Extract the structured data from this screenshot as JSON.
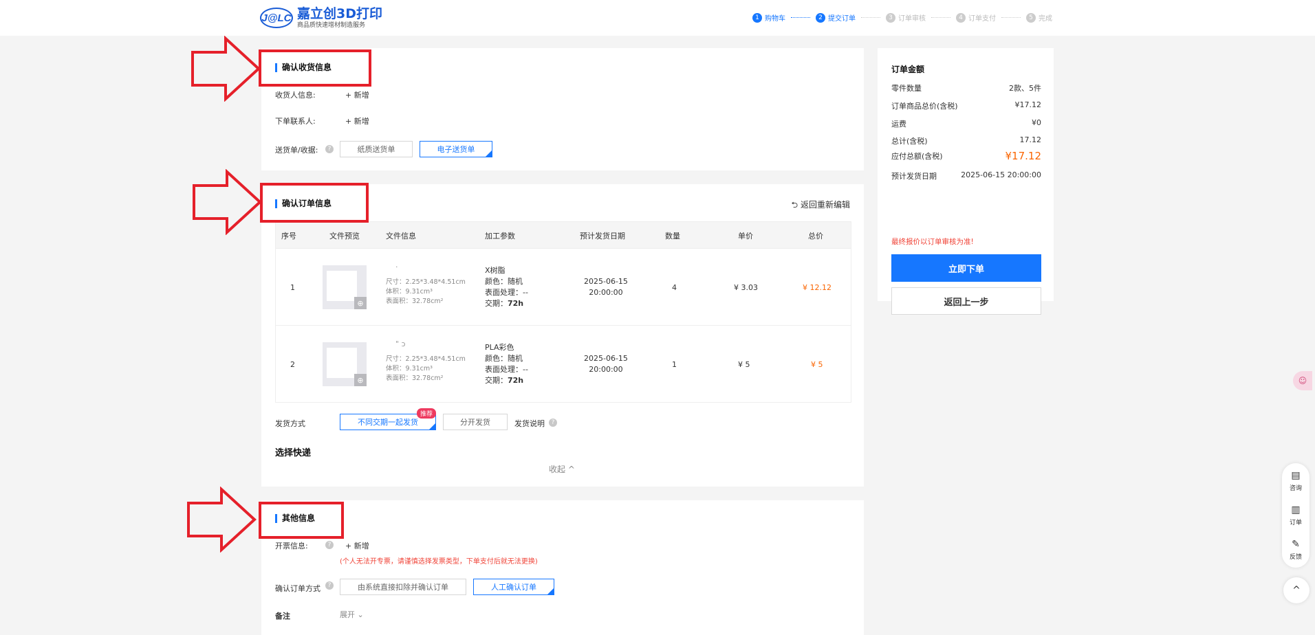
{
  "header": {
    "logo_badge": "J@LC",
    "logo_title": "嘉立创3D打印",
    "logo_sub": "商品质快速增材制造服务",
    "steps": [
      {
        "num": "1",
        "label": "购物车",
        "active": true
      },
      {
        "num": "2",
        "label": "提交订单",
        "active": true
      },
      {
        "num": "3",
        "label": "订单审核",
        "active": false
      },
      {
        "num": "4",
        "label": "订单支付",
        "active": false
      },
      {
        "num": "5",
        "label": "完成",
        "active": false
      }
    ]
  },
  "shipping": {
    "title": "确认收货信息",
    "receiver_label": "收货人信息:",
    "receiver_add": "+ 新增",
    "contact_label": "下单联系人:",
    "contact_add": "+ 新增",
    "receipt_label": "送货单/收据:",
    "receipt_options": [
      "纸质送货单",
      "电子送货单"
    ]
  },
  "order": {
    "title": "确认订单信息",
    "back_edit": "返回重新编辑",
    "columns": [
      "序号",
      "文件预览",
      "文件信息",
      "加工参数",
      "预计发货日期",
      "数量",
      "单价",
      "总价"
    ],
    "rows": [
      {
        "index": "1",
        "file_name": "·",
        "size": "尺寸：2.25*3.48*4.51cm",
        "volume": "体积：9.31cm³",
        "area": "表面积：32.78cm²",
        "material": "X树脂",
        "color": "颜色：随机",
        "surface": "表面处理：--",
        "lead_prefix": "交期：",
        "lead": "72h",
        "date": "2025-06-15",
        "time": "20:00:00",
        "qty": "4",
        "unit_price": "¥ 3.03",
        "total": "¥ 12.12"
      },
      {
        "index": "2",
        "file_name": "\" ɔ",
        "size": "尺寸：2.25*3.48*4.51cm",
        "volume": "体积：9.31cm³",
        "area": "表面积：32.78cm²",
        "material": "PLA彩色",
        "color": "颜色：随机",
        "surface": "表面处理：--",
        "lead_prefix": "交期：",
        "lead": "72h",
        "date": "2025-06-15",
        "time": "20:00:00",
        "qty": "1",
        "unit_price": "¥ 5",
        "total": "¥ 5"
      }
    ],
    "ship_label": "发货方式",
    "ship_options": [
      "不同交期一起发货",
      "分开发货"
    ],
    "ship_badge": "推荐",
    "ship_note": "发货说明",
    "express_label": "选择快递",
    "collapse": "收起 ^"
  },
  "other": {
    "title": "其他信息",
    "invoice_label": "开票信息:",
    "invoice_add": "+ 新增",
    "invoice_warning": "(个人无法开专票，请谨慎选择发票类型，下单支付后就无法更换)",
    "confirm_label": "确认订单方式",
    "confirm_options": [
      "由系统直接扣除并确认订单",
      "人工确认订单"
    ],
    "remark_label": "备注",
    "remark_expand": "展开 ⌄"
  },
  "summary": {
    "title": "订单金额",
    "rows": [
      {
        "label": "零件数量",
        "value": "2款、5件"
      },
      {
        "label": "订单商品总价(含税)",
        "value": "¥17.12"
      },
      {
        "label": "运费",
        "value": "¥0"
      },
      {
        "label": "总计(含税)",
        "value": "17.12"
      },
      {
        "label": "应付总额(含税)",
        "value": "¥17.12"
      },
      {
        "label": "预计发货日期",
        "value": "2025-06-15 20:00:00"
      }
    ],
    "note": "最终报价以订单审核为准!",
    "submit": "立即下单",
    "back": "返回上一步"
  },
  "floating": {
    "consult": "咨询",
    "orders": "订单",
    "feedback": "反馈",
    "top": "^"
  },
  "colors": {
    "primary": "#1677ff",
    "orange": "#fa6400",
    "annotation": "#e5202a"
  }
}
